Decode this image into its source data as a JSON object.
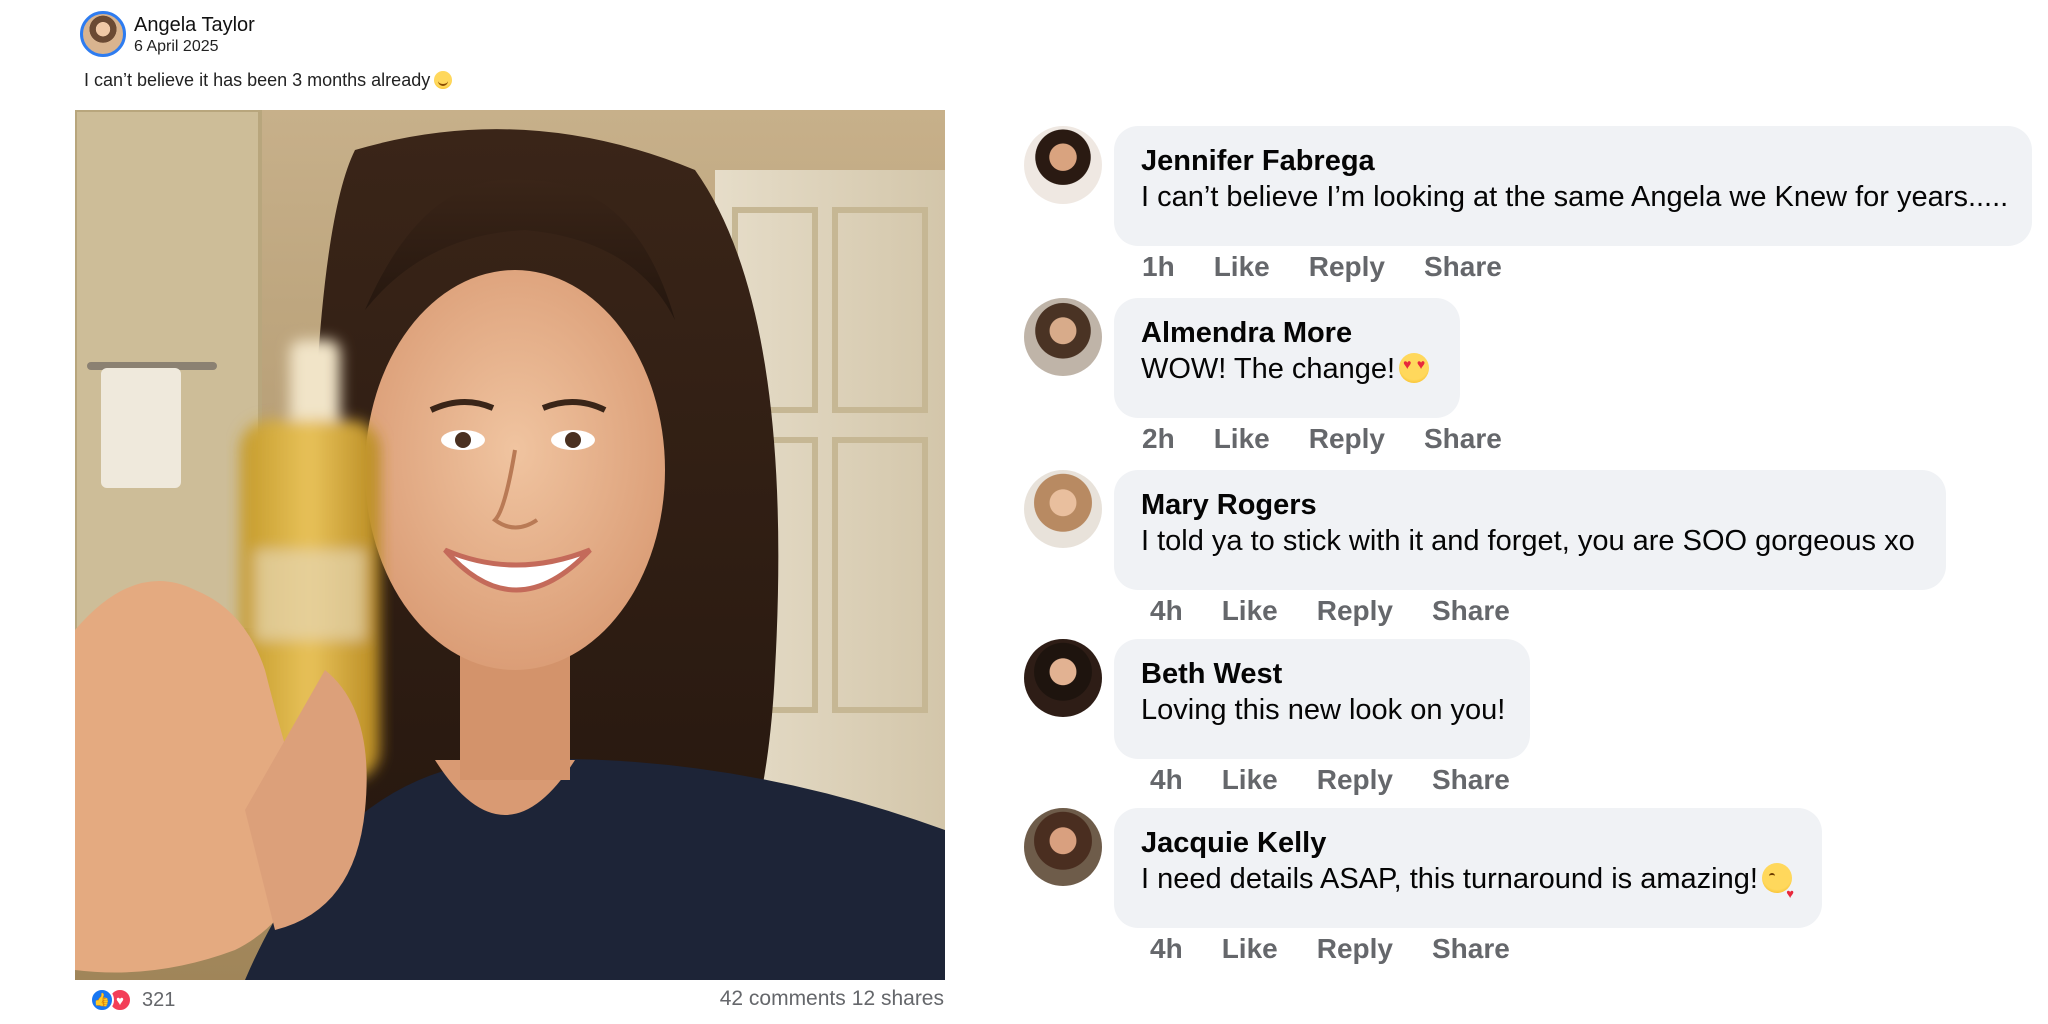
{
  "post": {
    "author": "Angela Taylor",
    "date": "6 April 2025",
    "caption": "I can’t believe it has been 3 months already",
    "reaction_count": "321",
    "comments_label": "42 comments",
    "shares_label": "12 shares"
  },
  "comment_actions": {
    "like": "Like",
    "reply": "Reply",
    "share": "Share"
  },
  "comments": [
    {
      "name": "Jennifer Fabrega",
      "text": "I can’t believe I’m looking at the same Angela we Knew for years.....",
      "time": "1h"
    },
    {
      "name": "Almendra More",
      "text": "WOW! The change!",
      "time": "2h"
    },
    {
      "name": "Mary Rogers",
      "text": "I told ya to stick with it and forget, you are SOO gorgeous xo",
      "time": "4h"
    },
    {
      "name": "Beth West",
      "text": "Loving this new look on you!",
      "time": "4h"
    },
    {
      "name": "Jacquie Kelly",
      "text": "I need details ASAP, this turnaround is amazing!",
      "time": "4h"
    }
  ],
  "colors": {
    "like_blue": "#1877f2",
    "love_red": "#f33e58",
    "bubble_bg": "#f0f2f5",
    "meta_gray": "#65676b"
  },
  "icons": {
    "caption_emoji": "smiling-face-icon",
    "comment2_emoji": "heart-eyes-emoji-icon",
    "comment5_emoji": "blowing-kiss-emoji-icon"
  }
}
